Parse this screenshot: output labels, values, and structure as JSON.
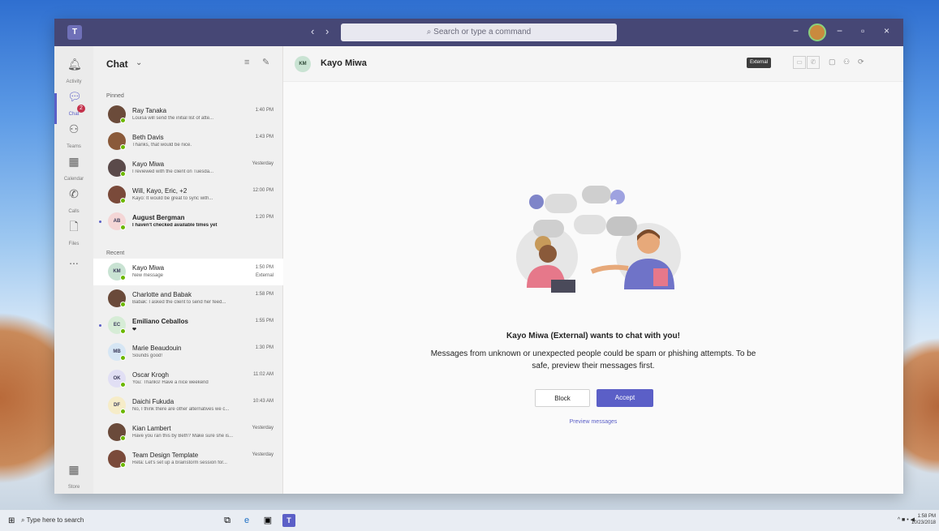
{
  "titlebar": {
    "back": "‹",
    "forward": "›",
    "search_placeholder": "Search or type a command",
    "minimize": "−",
    "restore": "▫",
    "close": "×"
  },
  "rail": {
    "items": [
      {
        "label": "Activity",
        "icon": "bell-icon"
      },
      {
        "label": "Chat",
        "icon": "chat-icon"
      },
      {
        "label": "Teams",
        "icon": "teams-icon"
      },
      {
        "label": "Calendar",
        "icon": "calendar-icon"
      },
      {
        "label": "Calls",
        "icon": "phone-icon"
      },
      {
        "label": "Files",
        "icon": "file-icon"
      },
      {
        "label": "...",
        "icon": "more-icon"
      }
    ],
    "chat_badge": "2",
    "store_label": "Store"
  },
  "chatlist": {
    "title": "Chat",
    "pinned_label": "Pinned",
    "recent_label": "Recent",
    "pinned": [
      {
        "name": "Ray Tanaka",
        "preview": "Louisa will send the initial list of atte...",
        "time": "1:40 PM",
        "initials": "",
        "color": "#6b4b3a"
      },
      {
        "name": "Beth Davis",
        "preview": "Thanks, that would be nice.",
        "time": "1:43 PM",
        "initials": "",
        "color": "#8a5a3a"
      },
      {
        "name": "Kayo Miwa",
        "preview": "I reviewed with the client on Tuesda...",
        "time": "Yesterday",
        "initials": "",
        "color": "#5a4a4a"
      },
      {
        "name": "Will, Kayo, Eric, +2",
        "preview": "Kayo: It would be great to sync with...",
        "time": "12:00 PM",
        "initials": "",
        "color": "#7a4a3a"
      },
      {
        "name": "August Bergman",
        "preview": "I haven't checked available times yet",
        "time": "1:20 PM",
        "initials": "AB",
        "color": "#f4d6d6",
        "bold": true
      }
    ],
    "recent": [
      {
        "name": "Kayo Miwa",
        "preview": "New message",
        "time": "1:50 PM",
        "sub": "External",
        "initials": "KM",
        "color": "#c9e3d3",
        "selected": true
      },
      {
        "name": "Charlotte and Babak",
        "preview": "Babak: I asked the client to send her feed...",
        "time": "1:58 PM",
        "initials": "",
        "color": "#6a4a3a"
      },
      {
        "name": "Emiliano Ceballos",
        "preview": "❤",
        "time": "1:55 PM",
        "initials": "EC",
        "color": "#d6ecd6",
        "bold": true
      },
      {
        "name": "Marie Beaudouin",
        "preview": "Sounds good!",
        "time": "1:30 PM",
        "initials": "MB",
        "color": "#d6e6f4"
      },
      {
        "name": "Oscar Krogh",
        "preview": "You: Thanks! Have a nice weekend",
        "time": "11:02 AM",
        "initials": "OK",
        "color": "#e1dff4"
      },
      {
        "name": "Daichi Fukuda",
        "preview": "No, I think there are other alternatives we c...",
        "time": "10:43 AM",
        "initials": "DF",
        "color": "#f6ecc8"
      },
      {
        "name": "Kian Lambert",
        "preview": "Have you ran this by Beth? Make sure she is...",
        "time": "Yesterday",
        "initials": "",
        "color": "#6a4a3a"
      },
      {
        "name": "Team Design Template",
        "preview": "Reta: Let's set up a brainstorm session for...",
        "time": "Yesterday",
        "initials": "",
        "color": "#7a4a3a"
      }
    ]
  },
  "main": {
    "contact_initials": "KM",
    "contact_name": "Kayo Miwa",
    "external_badge": "External",
    "prompt_title": "Kayo Miwa (External) wants to chat with you!",
    "prompt_body": "Messages from unknown or unexpected people could be spam or phishing attempts. To be safe, preview their messages first.",
    "block_label": "Block",
    "accept_label": "Accept",
    "preview_label": "Preview messages"
  },
  "taskbar": {
    "search_placeholder": "Type here to search",
    "time": "1:58 PM",
    "date": "10/23/2018",
    "tray": "^ ■ • ◀"
  },
  "colors": {
    "accent": "#5b5fc7",
    "titlebar": "#464775",
    "presence": "#6bb700"
  }
}
